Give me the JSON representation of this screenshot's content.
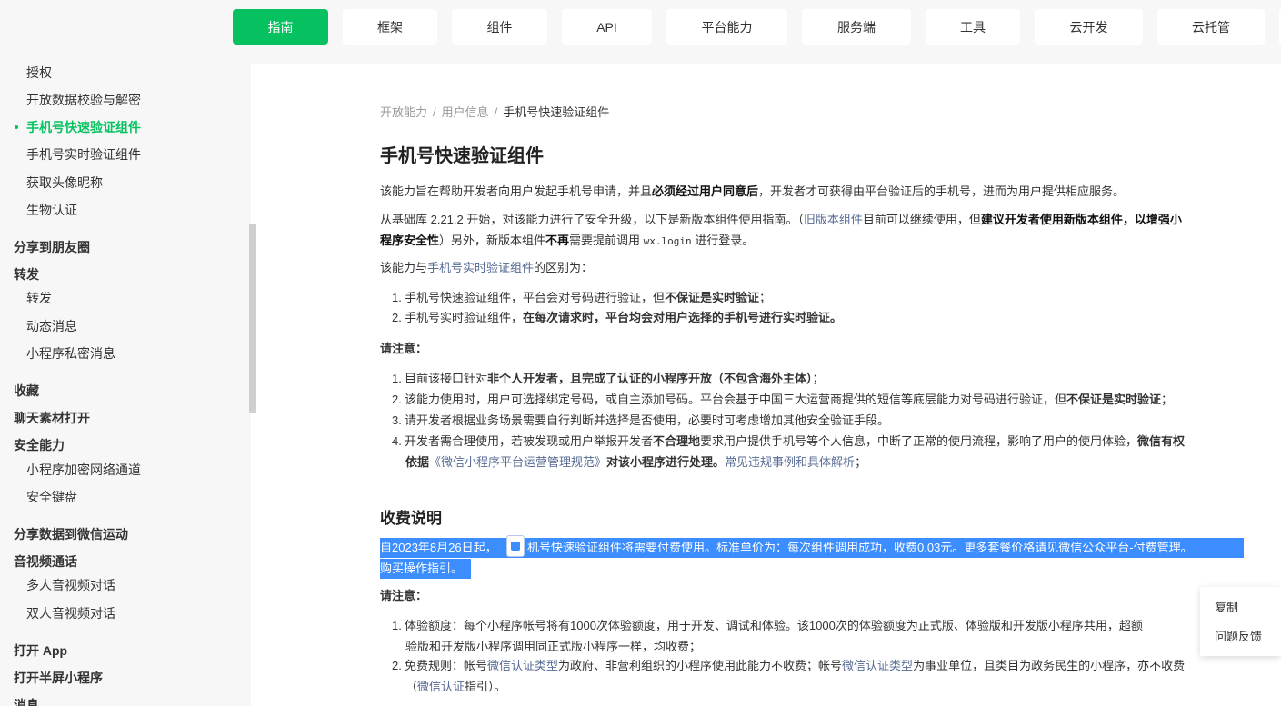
{
  "top_nav": {
    "tabs": [
      {
        "label": "指南",
        "active": true
      },
      {
        "label": "框架"
      },
      {
        "label": "组件"
      },
      {
        "label": "API"
      },
      {
        "label": "平台能力"
      },
      {
        "label": "服务端"
      },
      {
        "label": "工具"
      },
      {
        "label": "云开发"
      },
      {
        "label": "云托管"
      }
    ],
    "accent_color": "#07c160"
  },
  "sidebar": {
    "items": [
      {
        "label": "授权"
      },
      {
        "label": "开放数据校验与解密"
      },
      {
        "label": "手机号快速验证组件",
        "active": true
      },
      {
        "label": "手机号实时验证组件"
      },
      {
        "label": "获取头像昵称"
      },
      {
        "label": "生物认证"
      },
      {
        "label": "分享到朋友圈"
      },
      {
        "label": "转发"
      },
      {
        "label": "转发"
      },
      {
        "label": "动态消息"
      },
      {
        "label": "小程序私密消息"
      },
      {
        "label": "收藏"
      },
      {
        "label": "聊天素材打开"
      },
      {
        "label": "安全能力"
      },
      {
        "label": "小程序加密网络通道"
      },
      {
        "label": "安全键盘"
      },
      {
        "label": "分享数据到微信运动"
      },
      {
        "label": "音视频通话"
      },
      {
        "label": "多人音视频对话"
      },
      {
        "label": "双人音视频对话"
      },
      {
        "label": "打开 App"
      },
      {
        "label": "打开半屏小程序"
      },
      {
        "label": "消息"
      }
    ]
  },
  "breadcrumb": {
    "items": [
      "开放能力",
      "用户信息",
      "手机号快速验证组件"
    ]
  },
  "article": {
    "title": "手机号快速验证组件",
    "intro": {
      "a": "该能力旨在帮助开发者向用户发起手机号申请，并且",
      "b": "必须经过用户同意后",
      "c": "，开发者才可获得由平台验证后的手机号，进而为用户提供相应服务。"
    },
    "upgrade": {
      "a": "从基础库 2.21.2 开始，对该能力进行了安全升级，以下是新版本组件使用指南。（",
      "link": "旧版本组件",
      "b": "目前可以继续使用，但",
      "c": "建议开发者使用新版本组件，以增强小",
      "d": "程序安全性",
      "e": "）另外，新版本组件",
      "f": "不再",
      "g": "需要提前调用 ",
      "code": "wx.login",
      "h": " 进行登录。"
    },
    "diff": {
      "a": "该能力与",
      "link": "手机号实时验证组件",
      "b": "的区别为："
    },
    "diff_list": [
      {
        "num": "1.",
        "a": "手机号快速验证组件，平台会对号码进行验证，但",
        "b": "不保证是实时验证",
        "c": "；"
      },
      {
        "num": "2.",
        "a": "手机号实时验证组件，",
        "b": "在每次请求时，平台均会对用户选择的手机号进行实时验证。",
        "c": ""
      }
    ],
    "note_label": "请注意：",
    "notes": {
      "n1": {
        "num": "1.",
        "a": "目前该接口针对",
        "b": "非个人开发者，且完成了认证的小程序开放（不包含海外主体）",
        "c": "；"
      },
      "n2": {
        "num": "2.",
        "a": "该能力使用时，用户可选择绑定号码，或自主添加号码。平台会基于中国三大运营商提供的短信等底层能力对号码进行验证，但",
        "b": "不保证是实时验证",
        "c": "；"
      },
      "n3": {
        "num": "3.",
        "a": "请开发者根据业务场景需要自行判断并选择是否使用，必要时可考虑增加其他安全验证手段。"
      },
      "n4": {
        "num": "4.",
        "a": "开发者需合理使用，若被发现或用户举报开发者",
        "b": "不合理地",
        "c": "要求用户提供手机号等个人信息，中断了正常的使用流程，影响了用户的使用体验，",
        "d": "微信有权",
        "e": "依据",
        "link1": "《微信小程序平台运营管理规范》",
        "f": "对该小程序进行处理。",
        "link2": "常见违规事例和具体解析",
        "g": "；"
      }
    },
    "fee_title": "收费说明",
    "fee_line1_a": "自2023年8月26日起，",
    "fee_line1_b": "机号快速验证组件将需要付费使用。标准单价为：每次组件调用成功，收费0.03元。更多套餐价格请见微信公众平台-付费管理。",
    "fee_line2": "购买操作指引。",
    "note_label2": "请注意：",
    "fee_rules": {
      "r1": {
        "num": "1.",
        "a": "体验额度：每个小程序帐号将有1000次体验额度，用于开发、调试和体验。该1000次的体验额度为正式版、体验版和开发版小程序共用，超额",
        "b": "验版和开发版小程序调用同正式版小程序一样，均收费；"
      },
      "r2": {
        "num": "2.",
        "a": "免费规则：帐号",
        "link1": "微信认证类型",
        "b": "为政府、非营利组织的小程序使用此能力不收费；帐号",
        "link2": "微信认证类型",
        "c": "为事业单位，且类目为政务民生的小程序，亦不收费",
        "d": "（",
        "link3": "微信认证",
        "e": "指引）。"
      }
    }
  },
  "context_menu": {
    "items": [
      "复制",
      "问题反馈"
    ]
  }
}
